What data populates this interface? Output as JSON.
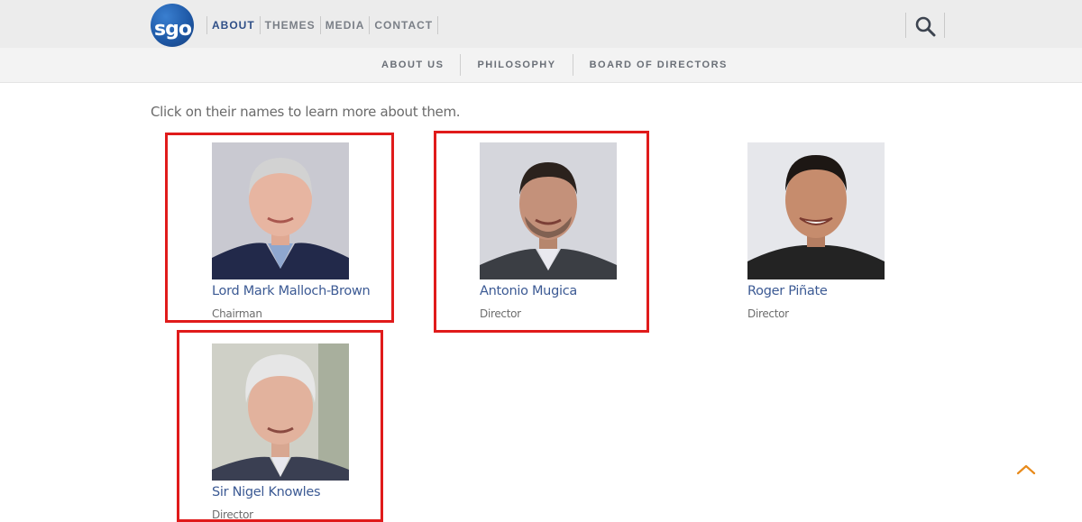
{
  "header": {
    "logo_text": "sgo",
    "nav": [
      "ABOUT",
      "THEMES",
      "MEDIA",
      "CONTACT"
    ]
  },
  "subnav": [
    "ABOUT US",
    "PHILOSOPHY",
    "BOARD OF DIRECTORS"
  ],
  "intro": "Click on their names to learn more about them.",
  "board": [
    {
      "name": "Lord Mark Malloch-Brown",
      "role": "Chairman"
    },
    {
      "name": "Antonio Mugica",
      "role": "Director"
    },
    {
      "name": "Roger Piñate",
      "role": "Director"
    },
    {
      "name": "Sir Nigel Knowles",
      "role": "Director"
    }
  ],
  "colors": {
    "accent": "#2f4f87",
    "link": "#3c5a94",
    "highlight": "#e01b1b",
    "scroll_top": "#e88a1a"
  },
  "icons": [
    "search-icon",
    "chevron-up-icon"
  ]
}
